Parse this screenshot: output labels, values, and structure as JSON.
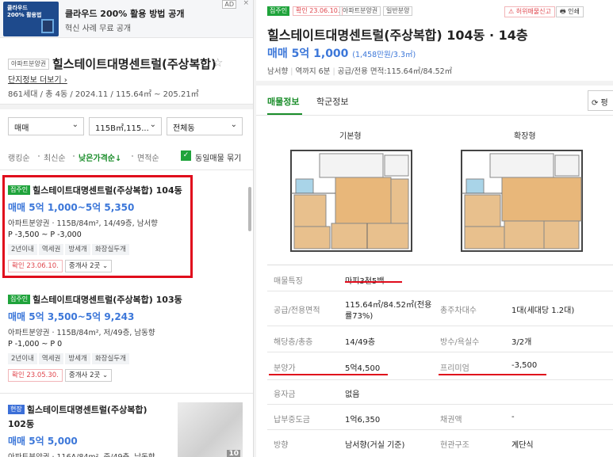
{
  "ad": {
    "thumb_text": "클라우드\n200% 활용법",
    "title": "클라우드 200% 활용 방법 공개",
    "subtitle": "혁신 사례 무료 공개",
    "badge": "AD",
    "close": "×"
  },
  "complex": {
    "type_tag": "아파트분양권",
    "name": "힐스테이트대명센트럴(주상복합)",
    "more_link": "단지정보 더보기",
    "info": "861세대 / 총 4동 / 2024.11 / 115.64㎡ ~ 205.21㎡"
  },
  "filters": {
    "trade": "매매",
    "area": "115B㎡,115...",
    "building": "전체동"
  },
  "sort": {
    "options": [
      "랭킹순",
      "최신순",
      "낮은가격순↓",
      "면적순"
    ],
    "same_listing_label": "동일매물 묶기"
  },
  "listings": [
    {
      "badge": "집주인",
      "title": "힐스테이트대명센트럴(주상복합) 104동",
      "price": "매매 5억 1,000~5억 5,350",
      "spec": "아파트분양권 · 115B/84m², 14/49층, 남서향",
      "pp": "P -3,500 ~ P -3,000",
      "chips": [
        "2년이내",
        "역세권",
        "방세개",
        "화장실두개"
      ],
      "confirm": "확인 23.06.10.",
      "agents": "중개사 2곳"
    },
    {
      "badge": "집주인",
      "title": "힐스테이트대명센트럴(주상복합) 103동",
      "price": "매매 5억 3,500~5억 9,243",
      "spec": "아파트분양권 · 115B/84m², 저/49층, 남동향",
      "pp": "P -1,000 ~ P 0",
      "chips": [
        "2년이내",
        "역세권",
        "방세개",
        "화장실두개"
      ],
      "confirm": "확인 23.05.30.",
      "agents": "중개사 2곳"
    },
    {
      "badge": "현장",
      "title": "힐스테이트대명센트럴(주상복합)",
      "title2": "102동",
      "price": "매매 5억 5,000",
      "spec": "아파트분양권 · 116A/84m², 중/49층, 남동향",
      "photo_count": "10"
    }
  ],
  "detail": {
    "tags": [
      "집주인",
      "확인 23.06.10.",
      "아파트분양권",
      "일반분양"
    ],
    "report": "허위매물신고",
    "print": "인쇄",
    "title": "힐스테이트대명센트럴(주상복합) 104동 · 14층",
    "price": "매매 5억 1,000",
    "price_unit": "(1,458만원/3.3㎡)",
    "meta": [
      "남서향",
      "역까지 6분",
      "공급/전용 면적:115.64㎡/84.52㎡"
    ],
    "tabs": [
      "매물정보",
      "학군정보"
    ],
    "refresh": "⟳ 평",
    "plans": [
      "기본형",
      "확장형"
    ],
    "table": {
      "feature_label": "매물특징",
      "feature_value": "마피3천5백",
      "area_label": "공급/전용면적",
      "area_value": "115.64㎡/84.52㎡(전용",
      "area_value2": "률73%)",
      "parking_label": "총주차대수",
      "parking_value": "1대(세대당 1.2대)",
      "floor_label": "해당층/총층",
      "floor_value": "14/49층",
      "rooms_label": "방수/욕실수",
      "rooms_value": "3/2개",
      "sale_price_label": "분양가",
      "sale_price_value": "5억4,500",
      "premium_label": "프리미엄",
      "premium_value": "-3,500",
      "loan_label": "융자금",
      "loan_value": "없음",
      "paid_label": "납부중도금",
      "paid_value": "1억6,350",
      "bond_label": "채권액",
      "bond_value": "-",
      "direction_label": "방향",
      "direction_value": "남서향(거실 기준)",
      "entrance_label": "현관구조",
      "entrance_value": "계단식"
    }
  },
  "colors": {
    "accent_green": "#1fa33b",
    "price_blue": "#3c77d9",
    "highlight_red": "#e00c1c"
  }
}
